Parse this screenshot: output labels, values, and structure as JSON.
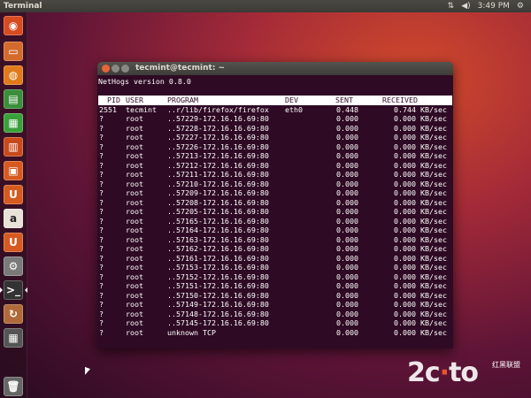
{
  "panel": {
    "title": "Terminal",
    "indicators": {
      "network": "⇅",
      "volume": "◀)",
      "time": "3:49 PM",
      "gear": "⚙"
    }
  },
  "launcher": [
    {
      "name": "dash",
      "glyph": "◉",
      "color": "#d84a20"
    },
    {
      "name": "files",
      "glyph": "▭",
      "color": "#d46a2c"
    },
    {
      "name": "firefox",
      "glyph": "◍",
      "color": "#e07a1a"
    },
    {
      "name": "writer",
      "glyph": "▤",
      "color": "#3a8e3a"
    },
    {
      "name": "calc",
      "glyph": "▦",
      "color": "#3aa03a"
    },
    {
      "name": "impress",
      "glyph": "▥",
      "color": "#c84a1c"
    },
    {
      "name": "software-center",
      "glyph": "▣",
      "color": "#d65a20"
    },
    {
      "name": "ubuntu-one",
      "glyph": "U",
      "color": "#d65a20"
    },
    {
      "name": "amazon",
      "glyph": "a",
      "color": "#e8e2d8"
    },
    {
      "name": "ubuntu-one-music",
      "glyph": "U",
      "color": "#d65a20"
    },
    {
      "name": "settings",
      "glyph": "⚙",
      "color": "#7a7a7a"
    },
    {
      "name": "terminal",
      "glyph": ">_",
      "color": "#333333"
    },
    {
      "name": "update-manager",
      "glyph": "↻",
      "color": "#b06a3a"
    },
    {
      "name": "workspaces",
      "glyph": "▦",
      "color": "#555555"
    },
    {
      "name": "trash",
      "glyph": "🗑",
      "color": "#666666"
    }
  ],
  "window": {
    "title": "tecmint@tecmint: ~"
  },
  "terminal": {
    "version_line": "NetHogs version 0.8.0",
    "headers": {
      "pid": "PID",
      "user": "USER",
      "program": "PROGRAM",
      "dev": "DEV",
      "sent": "SENT",
      "received": "RECEIVED"
    },
    "rows": [
      {
        "pid": "2551",
        "user": "tecmint",
        "program": "..r/lib/firefox/firefox",
        "dev": "eth0",
        "sent": "0.448",
        "recv": "0.744 KB/sec"
      },
      {
        "pid": "?",
        "user": "root",
        "program": "..57229-172.16.16.69:80",
        "dev": "",
        "sent": "0.000",
        "recv": "0.000 KB/sec"
      },
      {
        "pid": "?",
        "user": "root",
        "program": "..57228-172.16.16.69:80",
        "dev": "",
        "sent": "0.000",
        "recv": "0.000 KB/sec"
      },
      {
        "pid": "?",
        "user": "root",
        "program": "..57227-172.16.16.69:80",
        "dev": "",
        "sent": "0.000",
        "recv": "0.000 KB/sec"
      },
      {
        "pid": "?",
        "user": "root",
        "program": "..57226-172.16.16.69:80",
        "dev": "",
        "sent": "0.000",
        "recv": "0.000 KB/sec"
      },
      {
        "pid": "?",
        "user": "root",
        "program": "..57213-172.16.16.69:80",
        "dev": "",
        "sent": "0.000",
        "recv": "0.000 KB/sec"
      },
      {
        "pid": "?",
        "user": "root",
        "program": "..57212-172.16.16.69:80",
        "dev": "",
        "sent": "0.000",
        "recv": "0.000 KB/sec"
      },
      {
        "pid": "?",
        "user": "root",
        "program": "..57211-172.16.16.69:80",
        "dev": "",
        "sent": "0.000",
        "recv": "0.000 KB/sec"
      },
      {
        "pid": "?",
        "user": "root",
        "program": "..57210-172.16.16.69:80",
        "dev": "",
        "sent": "0.000",
        "recv": "0.000 KB/sec"
      },
      {
        "pid": "?",
        "user": "root",
        "program": "..57209-172.16.16.69:80",
        "dev": "",
        "sent": "0.000",
        "recv": "0.000 KB/sec"
      },
      {
        "pid": "?",
        "user": "root",
        "program": "..57208-172.16.16.69:80",
        "dev": "",
        "sent": "0.000",
        "recv": "0.000 KB/sec"
      },
      {
        "pid": "?",
        "user": "root",
        "program": "..57205-172.16.16.69:80",
        "dev": "",
        "sent": "0.000",
        "recv": "0.000 KB/sec"
      },
      {
        "pid": "?",
        "user": "root",
        "program": "..57165-172.16.16.69:80",
        "dev": "",
        "sent": "0.000",
        "recv": "0.000 KB/sec"
      },
      {
        "pid": "?",
        "user": "root",
        "program": "..57164-172.16.16.69:80",
        "dev": "",
        "sent": "0.000",
        "recv": "0.000 KB/sec"
      },
      {
        "pid": "?",
        "user": "root",
        "program": "..57163-172.16.16.69:80",
        "dev": "",
        "sent": "0.000",
        "recv": "0.000 KB/sec"
      },
      {
        "pid": "?",
        "user": "root",
        "program": "..57162-172.16.16.69:80",
        "dev": "",
        "sent": "0.000",
        "recv": "0.000 KB/sec"
      },
      {
        "pid": "?",
        "user": "root",
        "program": "..57161-172.16.16.69:80",
        "dev": "",
        "sent": "0.000",
        "recv": "0.000 KB/sec"
      },
      {
        "pid": "?",
        "user": "root",
        "program": "..57153-172.16.16.69:80",
        "dev": "",
        "sent": "0.000",
        "recv": "0.000 KB/sec"
      },
      {
        "pid": "?",
        "user": "root",
        "program": "..57152-172.16.16.69:80",
        "dev": "",
        "sent": "0.000",
        "recv": "0.000 KB/sec"
      },
      {
        "pid": "?",
        "user": "root",
        "program": "..57151-172.16.16.69:80",
        "dev": "",
        "sent": "0.000",
        "recv": "0.000 KB/sec"
      },
      {
        "pid": "?",
        "user": "root",
        "program": "..57150-172.16.16.69:80",
        "dev": "",
        "sent": "0.000",
        "recv": "0.000 KB/sec"
      },
      {
        "pid": "?",
        "user": "root",
        "program": "..57149-172.16.16.69:80",
        "dev": "",
        "sent": "0.000",
        "recv": "0.000 KB/sec"
      },
      {
        "pid": "?",
        "user": "root",
        "program": "..57148-172.16.16.69:80",
        "dev": "",
        "sent": "0.000",
        "recv": "0.000 KB/sec"
      },
      {
        "pid": "?",
        "user": "root",
        "program": "..57145-172.16.16.69:80",
        "dev": "",
        "sent": "0.000",
        "recv": "0.000 KB/sec"
      },
      {
        "pid": "?",
        "user": "root",
        "program": "unknown TCP",
        "dev": "",
        "sent": "0.000",
        "recv": "0.000 KB/sec"
      }
    ]
  },
  "watermark": {
    "text_a": "2c",
    "text_b": "to",
    "sub": "红黑联盟"
  }
}
